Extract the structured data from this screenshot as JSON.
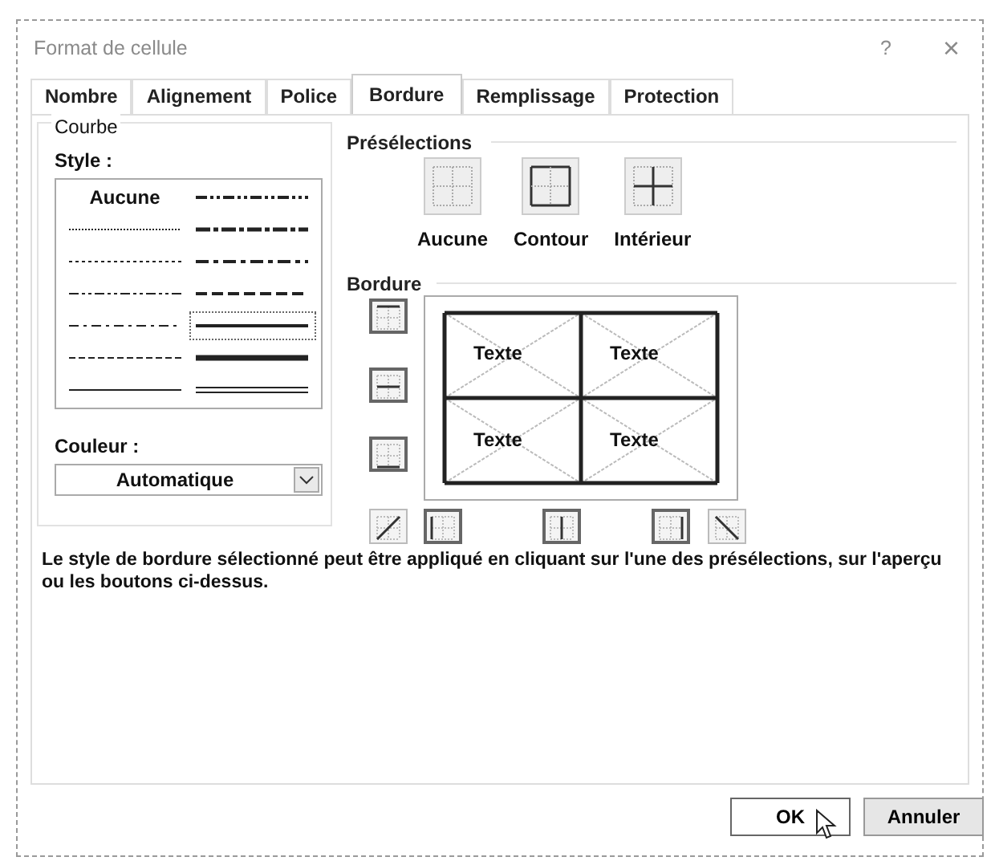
{
  "window": {
    "title": "Format de cellule",
    "help": "?",
    "close": "×"
  },
  "tabs": [
    {
      "label": "Nombre",
      "selected": false
    },
    {
      "label": "Alignement",
      "selected": false
    },
    {
      "label": "Police",
      "selected": false
    },
    {
      "label": "Bordure",
      "selected": true
    },
    {
      "label": "Remplissage",
      "selected": false
    },
    {
      "label": "Protection",
      "selected": false
    }
  ],
  "line_group": {
    "title": "Courbe",
    "style_label": {
      "text": "Style :"
    },
    "styles": [
      {
        "kind": "none",
        "label": "Aucune",
        "selected": false
      },
      {
        "kind": "hair",
        "selected": false
      },
      {
        "kind": "dotted",
        "selected": false
      },
      {
        "kind": "dash-dot-dot",
        "selected": false
      },
      {
        "kind": "dash-dot",
        "selected": false
      },
      {
        "kind": "dashed",
        "selected": false
      },
      {
        "kind": "thin",
        "selected": false
      },
      {
        "kind": "medium-dash-dot-dot",
        "selected": false
      },
      {
        "kind": "slant-dash-dot",
        "selected": false
      },
      {
        "kind": "medium-dash-dot",
        "selected": false
      },
      {
        "kind": "medium-dashed",
        "selected": false
      },
      {
        "kind": "medium",
        "selected": true
      },
      {
        "kind": "thick",
        "selected": false
      },
      {
        "kind": "double",
        "selected": false
      }
    ],
    "color_label": {
      "text": "Couleur :"
    },
    "color_value": "Automatique"
  },
  "presets": {
    "title": "Présélections",
    "items": [
      {
        "kind": "none",
        "label": "Aucune"
      },
      {
        "kind": "outline",
        "label": "Contour"
      },
      {
        "kind": "inside",
        "label": "Intérieur"
      }
    ]
  },
  "border": {
    "title": "Bordure",
    "preview_texts": [
      "Texte",
      "Texte",
      "Texte",
      "Texte"
    ],
    "buttons": [
      {
        "kind": "top",
        "pressed": true
      },
      {
        "kind": "horizontal",
        "pressed": true
      },
      {
        "kind": "bottom",
        "pressed": true
      },
      {
        "kind": "diag-up",
        "pressed": false
      },
      {
        "kind": "left",
        "pressed": true
      },
      {
        "kind": "vertical",
        "pressed": true
      },
      {
        "kind": "right",
        "pressed": true
      },
      {
        "kind": "diag-down",
        "pressed": false
      }
    ]
  },
  "description": "Le style de bordure sélectionné peut être appliqué en cliquant sur l'une des présélections, sur l'aperçu ou les boutons ci-dessus.",
  "buttons": [
    {
      "label": "OK",
      "default": true
    },
    {
      "label": "Annuler",
      "default": false
    }
  ]
}
